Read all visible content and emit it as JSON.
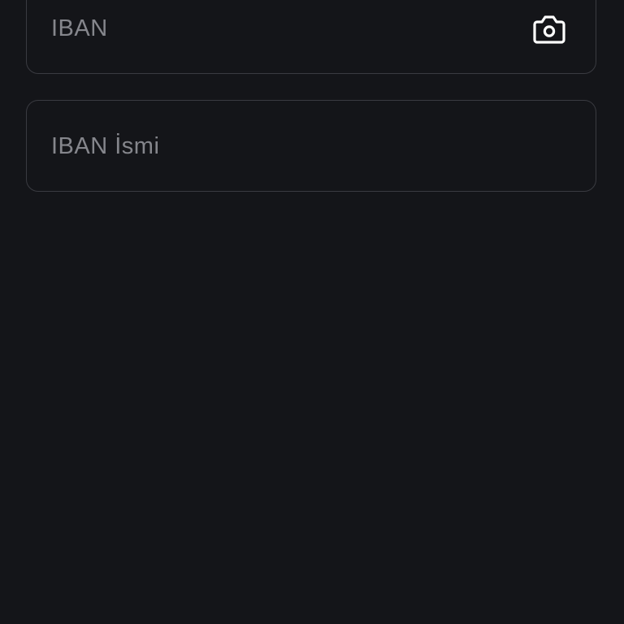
{
  "form": {
    "iban_field": {
      "placeholder": "IBAN",
      "value": "",
      "action_icon": "camera-icon"
    },
    "iban_name_field": {
      "placeholder": "IBAN İsmi",
      "value": ""
    }
  },
  "colors": {
    "background": "#141519",
    "field_border": "#3a3b41",
    "placeholder": "#85868c",
    "icon": "#ffffff"
  }
}
